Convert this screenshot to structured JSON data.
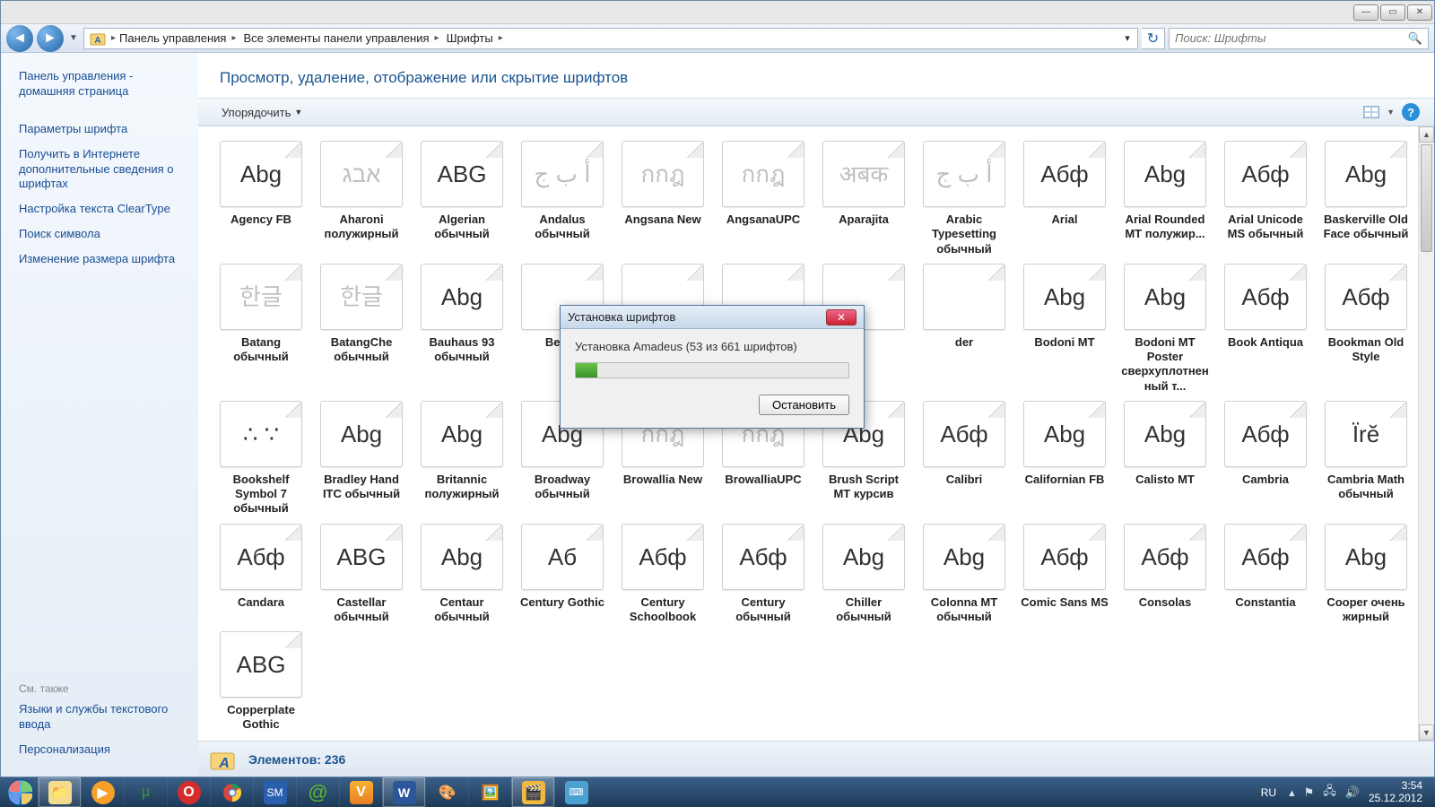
{
  "window_controls": {
    "min": "—",
    "max": "▭",
    "close": "✕"
  },
  "breadcrumb": {
    "seg1": "Панель управления",
    "seg2": "Все элементы панели управления",
    "seg3": "Шрифты"
  },
  "search": {
    "placeholder": "Поиск: Шрифты"
  },
  "sidebar": {
    "links": [
      "Панель управления - домашняя страница",
      "Параметры шрифта",
      "Получить в Интернете дополнительные сведения о шрифтах",
      "Настройка текста ClearType",
      "Поиск символа",
      "Изменение размера шрифта"
    ],
    "see_also_label": "См. также",
    "see_also": [
      "Языки и службы текстового ввода",
      "Персонализация"
    ]
  },
  "page_title": "Просмотр, удаление, отображение или скрытие шрифтов",
  "toolbar": {
    "organize": "Упорядочить"
  },
  "fonts": [
    {
      "s": "Abg",
      "n": "Agency FB",
      "stack": true,
      "cls": ""
    },
    {
      "s": "אבג",
      "n": "Aharoni полужирный",
      "stack": false,
      "cls": "faded"
    },
    {
      "s": "ABG",
      "n": "Algerian обычный",
      "stack": false,
      "cls": ""
    },
    {
      "s": "أ ب ج",
      "n": "Andalus обычный",
      "stack": false,
      "cls": "faded"
    },
    {
      "s": "กกฎ",
      "n": "Angsana New",
      "stack": true,
      "cls": "faded"
    },
    {
      "s": "กกฎ",
      "n": "AngsanaUPC",
      "stack": true,
      "cls": "faded"
    },
    {
      "s": "अबक",
      "n": "Aparajita",
      "stack": true,
      "cls": "faded"
    },
    {
      "s": "أ ب ج",
      "n": "Arabic Typesetting обычный",
      "stack": false,
      "cls": "faded"
    },
    {
      "s": "Абф",
      "n": "Arial",
      "stack": true,
      "cls": ""
    },
    {
      "s": "Abg",
      "n": "Arial Rounded MT полужир...",
      "stack": false,
      "cls": ""
    },
    {
      "s": "Абф",
      "n": "Arial Unicode MS обычный",
      "stack": false,
      "cls": ""
    },
    {
      "s": "Abg",
      "n": "Baskerville Old Face обычный",
      "stack": false,
      "cls": ""
    },
    {
      "s": "한글",
      "n": "Batang обычный",
      "stack": false,
      "cls": "faded"
    },
    {
      "s": "한글",
      "n": "BatangChe обычный",
      "stack": false,
      "cls": "faded"
    },
    {
      "s": "Abg",
      "n": "Bauhaus 93 обычный",
      "stack": false,
      "cls": ""
    },
    {
      "s": "",
      "n": "Bell M",
      "stack": true,
      "cls": ""
    },
    {
      "s": "",
      "n": "",
      "stack": true,
      "cls": ""
    },
    {
      "s": "",
      "n": "",
      "stack": true,
      "cls": ""
    },
    {
      "s": "",
      "n": "",
      "stack": true,
      "cls": ""
    },
    {
      "s": "",
      "n": "der",
      "stack": false,
      "cls": ""
    },
    {
      "s": "Abg",
      "n": "Bodoni MT",
      "stack": true,
      "cls": ""
    },
    {
      "s": "Abg",
      "n": "Bodoni MT Poster сверхуплотненный т...",
      "stack": false,
      "cls": ""
    },
    {
      "s": "Абф",
      "n": "Book Antiqua",
      "stack": true,
      "cls": ""
    },
    {
      "s": "Абф",
      "n": "Bookman Old Style",
      "stack": true,
      "cls": ""
    },
    {
      "s": "∴ ∵",
      "n": "Bookshelf Symbol 7 обычный",
      "stack": false,
      "cls": ""
    },
    {
      "s": "Abg",
      "n": "Bradley Hand ITC обычный",
      "stack": false,
      "cls": ""
    },
    {
      "s": "Abg",
      "n": "Britannic полужирный",
      "stack": false,
      "cls": ""
    },
    {
      "s": "Abg",
      "n": "Broadway обычный",
      "stack": false,
      "cls": ""
    },
    {
      "s": "กกฎ",
      "n": "Browallia New",
      "stack": true,
      "cls": "faded"
    },
    {
      "s": "กกฎ",
      "n": "BrowalliaUPC",
      "stack": true,
      "cls": "faded"
    },
    {
      "s": "Abg",
      "n": "Brush Script MT курсив",
      "stack": false,
      "cls": ""
    },
    {
      "s": "Абф",
      "n": "Calibri",
      "stack": true,
      "cls": ""
    },
    {
      "s": "Abg",
      "n": "Californian FB",
      "stack": true,
      "cls": ""
    },
    {
      "s": "Abg",
      "n": "Calisto MT",
      "stack": true,
      "cls": ""
    },
    {
      "s": "Абф",
      "n": "Cambria",
      "stack": true,
      "cls": ""
    },
    {
      "s": "Ïrĕ",
      "n": "Cambria Math обычный",
      "stack": false,
      "cls": ""
    },
    {
      "s": "Абф",
      "n": "Candara",
      "stack": true,
      "cls": ""
    },
    {
      "s": "ABG",
      "n": "Castellar обычный",
      "stack": false,
      "cls": ""
    },
    {
      "s": "Abg",
      "n": "Centaur обычный",
      "stack": false,
      "cls": ""
    },
    {
      "s": "Аб",
      "n": "Century Gothic",
      "stack": true,
      "cls": ""
    },
    {
      "s": "Абф",
      "n": "Century Schoolbook",
      "stack": true,
      "cls": ""
    },
    {
      "s": "Абф",
      "n": "Century обычный",
      "stack": false,
      "cls": ""
    },
    {
      "s": "Abg",
      "n": "Chiller обычный",
      "stack": false,
      "cls": ""
    },
    {
      "s": "Abg",
      "n": "Colonna MT обычный",
      "stack": false,
      "cls": ""
    },
    {
      "s": "Абф",
      "n": "Comic Sans MS",
      "stack": true,
      "cls": ""
    },
    {
      "s": "Абф",
      "n": "Consolas",
      "stack": true,
      "cls": ""
    },
    {
      "s": "Абф",
      "n": "Constantia",
      "stack": true,
      "cls": ""
    },
    {
      "s": "Abg",
      "n": "Cooper очень жирный",
      "stack": false,
      "cls": ""
    },
    {
      "s": "ABG",
      "n": "Copperplate Gothic",
      "stack": true,
      "cls": ""
    }
  ],
  "status": {
    "count_label": "Элементов: 236"
  },
  "dialog": {
    "title": "Установка шрифтов",
    "message": "Установка Amadeus (53 из 661 шрифтов)",
    "stop": "Остановить"
  },
  "tray": {
    "lang": "RU",
    "time": "3:54",
    "date": "25.12.2012"
  }
}
